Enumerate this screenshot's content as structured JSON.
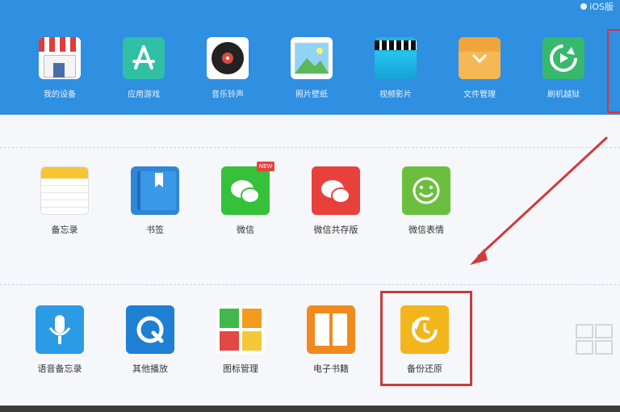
{
  "version_label": "iOS版",
  "top_nav": [
    {
      "id": "my-device",
      "label": "我的设备",
      "icon": "store-icon"
    },
    {
      "id": "apps-games",
      "label": "应用游戏",
      "icon": "app-store-icon"
    },
    {
      "id": "music",
      "label": "音乐铃声",
      "icon": "record-icon"
    },
    {
      "id": "wallpaper",
      "label": "照片壁纸",
      "icon": "picture-icon"
    },
    {
      "id": "video",
      "label": "视频影片",
      "icon": "film-icon"
    },
    {
      "id": "files",
      "label": "文件管理",
      "icon": "folder-icon"
    },
    {
      "id": "flash",
      "label": "刷机越狱",
      "icon": "refresh-icon"
    }
  ],
  "row1": [
    {
      "id": "memo",
      "label": "备忘录",
      "icon": "notepad-icon"
    },
    {
      "id": "bookmark",
      "label": "书签",
      "icon": "bookmark-icon"
    },
    {
      "id": "wechat",
      "label": "微信",
      "icon": "wechat-icon",
      "badge": "NEW"
    },
    {
      "id": "wechat-archive",
      "label": "微信共存版",
      "icon": "wechat-icon"
    },
    {
      "id": "wechat-emoji",
      "label": "微信表情",
      "icon": "smiley-icon"
    }
  ],
  "row2": [
    {
      "id": "voice-memo",
      "label": "语音备忘录",
      "icon": "microphone-icon"
    },
    {
      "id": "other",
      "label": "其他播放",
      "icon": "quicktime-icon"
    },
    {
      "id": "icon-manage",
      "label": "图标管理",
      "icon": "tiles-icon"
    },
    {
      "id": "ebook",
      "label": "电子书籍",
      "icon": "book-icon"
    },
    {
      "id": "backup",
      "label": "备份还原",
      "icon": "restore-icon"
    }
  ],
  "colors": {
    "header_blue": "#2f8fe0",
    "highlight_red": "#cc3b3b",
    "wechat_green": "#35c13a",
    "wechat_red": "#e8413c",
    "emoji_green": "#6cbf3e",
    "backup_yellow": "#f2b51c",
    "ebook_orange": "#f08a1e",
    "voice_blue": "#2b9be6",
    "quicktime_blue": "#1f7fd3"
  }
}
